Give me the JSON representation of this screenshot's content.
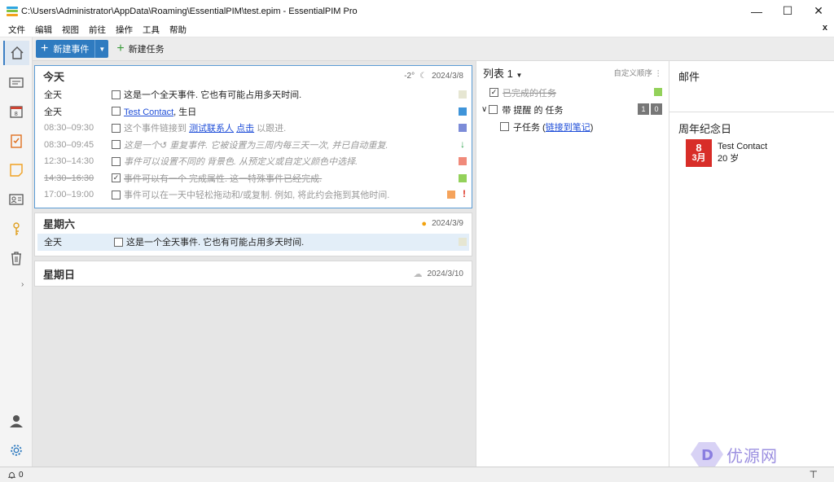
{
  "window": {
    "title": "C:\\Users\\Administrator\\AppData\\Roaming\\EssentialPIM\\test.epim - EssentialPIM Pro",
    "minimize": "—",
    "maximize": "☐",
    "close": "✕"
  },
  "menu": {
    "items": [
      "文件",
      "编辑",
      "视图",
      "前往",
      "操作",
      "工具",
      "帮助"
    ],
    "close_label": "x"
  },
  "toolbar": {
    "new_event_label": "新建事件",
    "new_task_label": "新建任务"
  },
  "days": [
    {
      "name": "今天",
      "weather": "-2°",
      "date": "2024/3/8",
      "events": [
        {
          "time": "全天",
          "text": "这是一个全天事件. 它也有可能占用多天时间.",
          "color": "#e6e6d2"
        },
        {
          "time": "全天",
          "link": "Test Contact",
          "suffix": ", 生日",
          "color": "#3f94d9"
        },
        {
          "time": "08:30–09:30",
          "prefix": "这个事件链接到 ",
          "link": "测试联系人",
          "mid": " ",
          "link2": "点击",
          "suffix": " 以跟进.",
          "color": "#7c8cd8"
        },
        {
          "time": "08:30–09:45",
          "text": "这是一个↺ 重复事件. 它被设置为三周内每三天一次, 并已自动重复.",
          "arrow": "↓"
        },
        {
          "time": "12:30–14:30",
          "text": "事件可以设置不同的 背景色. 从预定义或自定义颜色中选择.",
          "color": "#f08a7a"
        },
        {
          "time": "14:30–16:30",
          "text": "事件可以有一个 完成属性. 这一特殊事件已经完成.",
          "color": "#93d15a",
          "check": "✓"
        },
        {
          "time": "17:00–19:00",
          "text": "事件可以在一天中轻松拖动和/或复制. 例如, 将此约会拖到其他时间.",
          "color": "#f5a35b",
          "excl": "!"
        }
      ]
    },
    {
      "name": "星期六",
      "date": "2024/3/9",
      "events": [
        {
          "time": "全天",
          "text": "这是一个全天事件. 它也有可能占用多天时间.",
          "color": "#e6e6d2"
        }
      ]
    },
    {
      "name": "星期日",
      "date": "2024/3/10"
    }
  ],
  "tasks": {
    "title": "列表 1",
    "order_label": "自定义顺序",
    "items": [
      {
        "text": "已完成的任务",
        "check": "✓"
      },
      {
        "text": "带 提醒 的 任务",
        "badges": [
          "1",
          "0"
        ]
      },
      {
        "prefix": "子任务 (",
        "link": "链接到笔记",
        "suffix": ")"
      }
    ],
    "done_color": "#93d15a"
  },
  "right": {
    "mail_title": "邮件",
    "anniversary_title": "周年纪念日",
    "anniversary": {
      "day": "8",
      "month": "3月",
      "name": "Test Contact",
      "age": "20 岁"
    }
  },
  "watermark": {
    "text": "优源网"
  },
  "status": {
    "count": "0",
    "pin": "⊤"
  }
}
